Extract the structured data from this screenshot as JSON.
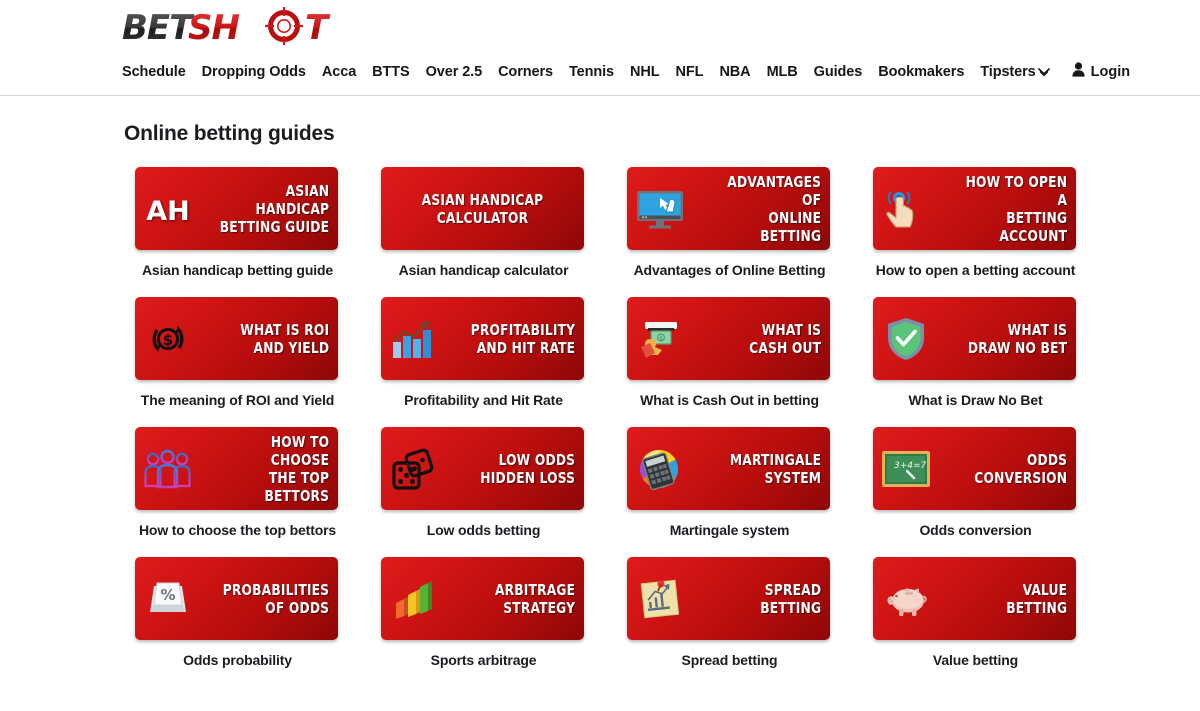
{
  "site": {
    "logo_text_1": "BET",
    "logo_text_2": "SH",
    "logo_text_3": "T",
    "logo_full": "BETSHOOT"
  },
  "nav": {
    "items": [
      {
        "label": "Schedule"
      },
      {
        "label": "Dropping Odds"
      },
      {
        "label": "Acca"
      },
      {
        "label": "BTTS"
      },
      {
        "label": "Over 2.5"
      },
      {
        "label": "Corners"
      },
      {
        "label": "Tennis"
      },
      {
        "label": "NHL"
      },
      {
        "label": "NFL"
      },
      {
        "label": "NBA"
      },
      {
        "label": "MLB"
      },
      {
        "label": "Guides"
      },
      {
        "label": "Bookmakers"
      },
      {
        "label": "Tipsters",
        "has_chevron": true
      }
    ],
    "login_label": "Login"
  },
  "main": {
    "title": "Online betting guides",
    "guides": [
      {
        "card_title_line1": "ASIAN HANDICAP",
        "card_title_line2": "BETTING GUIDE",
        "caption": "Asian handicap betting guide",
        "icon": "ah-text-icon"
      },
      {
        "card_title_line1": "ASIAN HANDICAP",
        "card_title_line2": "CALCULATOR",
        "caption": "Asian handicap calculator",
        "icon": "none"
      },
      {
        "card_title_line1": "ADVANTAGES OF",
        "card_title_line2": "ONLINE BETTING",
        "caption": "Advantages of Online Betting",
        "icon": "monitor-cursor-icon"
      },
      {
        "card_title_line1": "HOW TO OPEN A",
        "card_title_line2": "BETTING ACCOUNT",
        "caption": "How to open a betting account",
        "icon": "hand-tap-icon"
      },
      {
        "card_title_line1": "WHAT IS ROI",
        "card_title_line2": "AND YIELD",
        "caption": "The meaning of ROI and Yield",
        "icon": "roi-dollar-cycle-icon"
      },
      {
        "card_title_line1": "PROFITABILITY",
        "card_title_line2": "AND HIT RATE",
        "caption": "Profitability and Hit Rate",
        "icon": "bar-chart-arrow-icon"
      },
      {
        "card_title_line1": "WHAT IS",
        "card_title_line2": "CASH OUT",
        "caption": "What is Cash Out in betting",
        "icon": "atm-cash-hand-icon"
      },
      {
        "card_title_line1": "WHAT IS",
        "card_title_line2": "DRAW NO BET",
        "caption": "What is Draw No Bet",
        "icon": "shield-check-icon"
      },
      {
        "card_title_line1": "HOW TO CHOOSE",
        "card_title_line2": "THE TOP BETTORS",
        "caption": "How to choose the top bettors",
        "icon": "people-group-icon"
      },
      {
        "card_title_line1": "LOW ODDS",
        "card_title_line2": "HIDDEN LOSS",
        "caption": "Low odds betting",
        "icon": "dice-icon"
      },
      {
        "card_title_line1": "MARTINGALE",
        "card_title_line2": "SYSTEM",
        "caption": "Martingale system",
        "icon": "pie-calculator-icon"
      },
      {
        "card_title_line1": "ODDS",
        "card_title_line2": "CONVERSION",
        "caption": "Odds conversion",
        "icon": "chalkboard-icon",
        "icon_text": "3+4=7"
      },
      {
        "card_title_line1": "PROBABILITIES",
        "card_title_line2": "OF ODDS",
        "caption": "Odds probability",
        "icon": "percent-key-icon",
        "icon_text": "%"
      },
      {
        "card_title_line1": "ARBITRAGE",
        "card_title_line2": "STRATEGY",
        "caption": "Sports arbitrage",
        "icon": "bars-3d-icon"
      },
      {
        "card_title_line1": "SPREAD",
        "card_title_line2": "BETTING",
        "caption": "Spread betting",
        "icon": "sticky-note-chart-icon"
      },
      {
        "card_title_line1": "VALUE",
        "card_title_line2": "BETTING",
        "caption": "Value betting",
        "icon": "piggy-bank-icon"
      }
    ]
  },
  "colors": {
    "brand_red": "#cc0000",
    "card_red_light": "#e01b1b",
    "card_red_dark": "#8e0707",
    "text_dark": "#1a1c20"
  }
}
